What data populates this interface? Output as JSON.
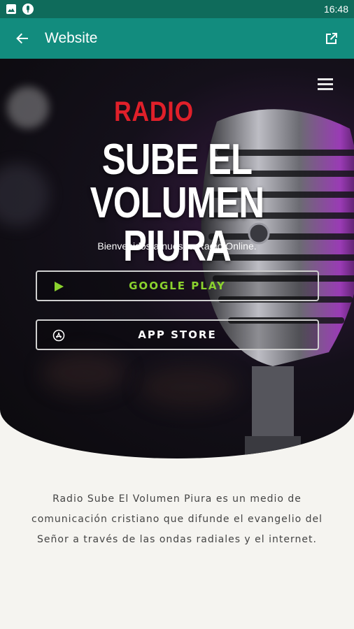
{
  "status_bar": {
    "time": "16:48"
  },
  "app_bar": {
    "title": "Website"
  },
  "hero": {
    "logo_text": "RADIO",
    "title_line1": "SUBE EL VOLUMEN",
    "title_line2": "PIURA",
    "subtitle": "Bienvenidos a nuestra Radio Online.",
    "google_play_label": "GOOGLE PLAY",
    "app_store_label": "APP STORE"
  },
  "about": {
    "text": "Radio Sube El Volumen Piura es un medio de comunicación cristiano que difunde el evangelio del Señor a través de las ondas radiales y el internet."
  },
  "colors": {
    "status_bar": "#0f6b5b",
    "app_bar": "#128c7e",
    "accent_green": "#8bd22e",
    "logo_red": "#e0202a"
  },
  "icons": [
    "image-icon",
    "mic-icon",
    "back-arrow-icon",
    "open-external-icon",
    "menu-icon",
    "play-icon",
    "app-store-icon"
  ]
}
